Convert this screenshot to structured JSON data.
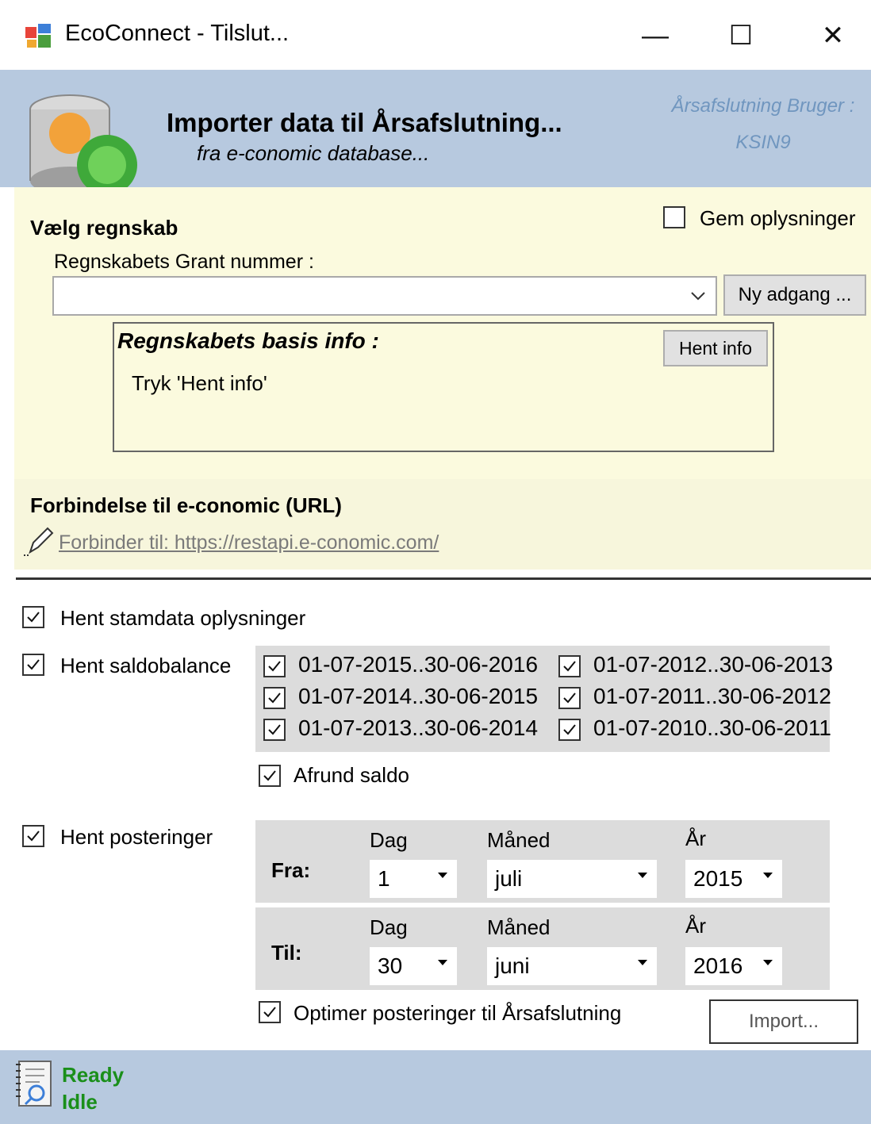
{
  "window": {
    "title": "EcoConnect - Tilslut...",
    "minimize": "—",
    "maximize": "☐",
    "close": "✕"
  },
  "header": {
    "title": "Importer data til Årsafslutning...",
    "subtitle": "fra e-conomic database...",
    "user_label": "Årsafslutning Bruger :",
    "user_value": "KSIN9"
  },
  "account": {
    "section_title": "Vælg regnskab",
    "save_checkbox_label": "Gem oplysninger",
    "save_checked": false,
    "grant_label": "Regnskabets Grant nummer :",
    "grant_value": "",
    "new_access_button": "Ny adgang ...",
    "basis_info_title": "Regnskabets basis info :",
    "fetch_info_button": "Hent info",
    "basis_info_text": "Tryk 'Hent info'"
  },
  "connection": {
    "title": "Forbindelse til e-conomic (URL)",
    "link_text": "Forbinder til: https://restapi.e-conomic.com/"
  },
  "options": {
    "stamdata_label": "Hent stamdata oplysninger",
    "saldo_label": "Hent saldobalance",
    "periods": [
      "01-07-2015..30-06-2016",
      "01-07-2014..30-06-2015",
      "01-07-2013..30-06-2014",
      "01-07-2012..30-06-2013",
      "01-07-2011..30-06-2012",
      "01-07-2010..30-06-2011"
    ],
    "round_label": "Afrund saldo",
    "postings_label": "Hent posteringer",
    "optimize_label": "Optimer posteringer til Årsafslutning"
  },
  "date_range": {
    "day_header": "Dag",
    "month_header": "Måned",
    "year_header": "År",
    "from_label": "Fra:",
    "to_label": "Til:",
    "from_day": "1",
    "from_month": "juli",
    "from_year": "2015",
    "to_day": "30",
    "to_month": "juni",
    "to_year": "2016"
  },
  "import_button": "Import...",
  "status": {
    "line1": "Ready",
    "line2": "Idle"
  },
  "colors": {
    "header_bg": "#b7c9df",
    "yellow_bg": "#fbfade",
    "status_text": "#1a8f1a",
    "user_text": "#7096bf"
  }
}
